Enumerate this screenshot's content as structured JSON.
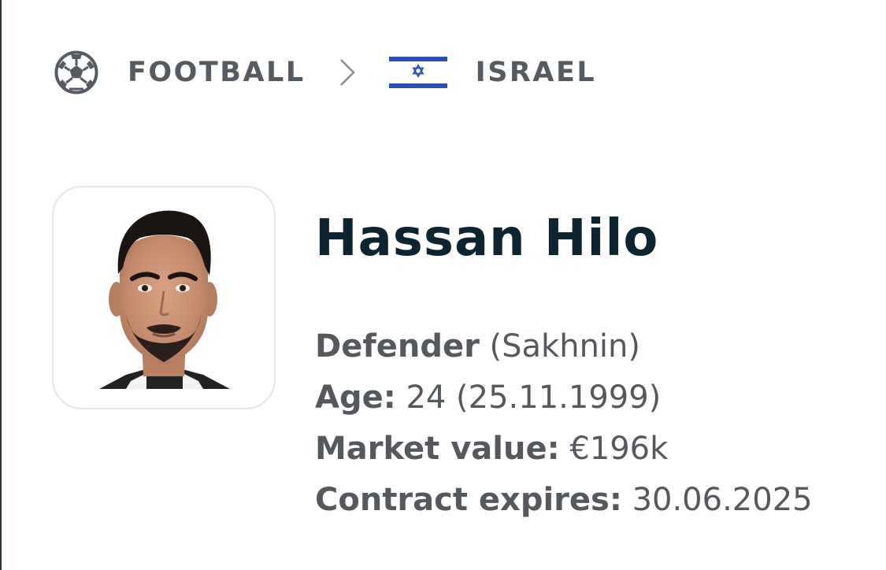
{
  "breadcrumb": {
    "sport": {
      "label": "FOOTBALL",
      "icon": "football-icon"
    },
    "separator_icon": "chevron-right-icon",
    "country": {
      "label": "ISRAEL",
      "icon": "israel-flag-icon"
    }
  },
  "player": {
    "name": "Hassan Hilo",
    "photo": "player-photo",
    "position": "Defender",
    "club": "(Sakhnin)",
    "age_label": "Age:",
    "age_value": "24 (25.11.1999)",
    "market_value_label": "Market value:",
    "market_value": "€196k",
    "contract_label": "Contract expires:",
    "contract_value": "30.06.2025"
  },
  "colors": {
    "name": "#0e2430",
    "text": "#55595d",
    "flag_blue": "#2b4fb0",
    "border": "#e6e6e6"
  }
}
